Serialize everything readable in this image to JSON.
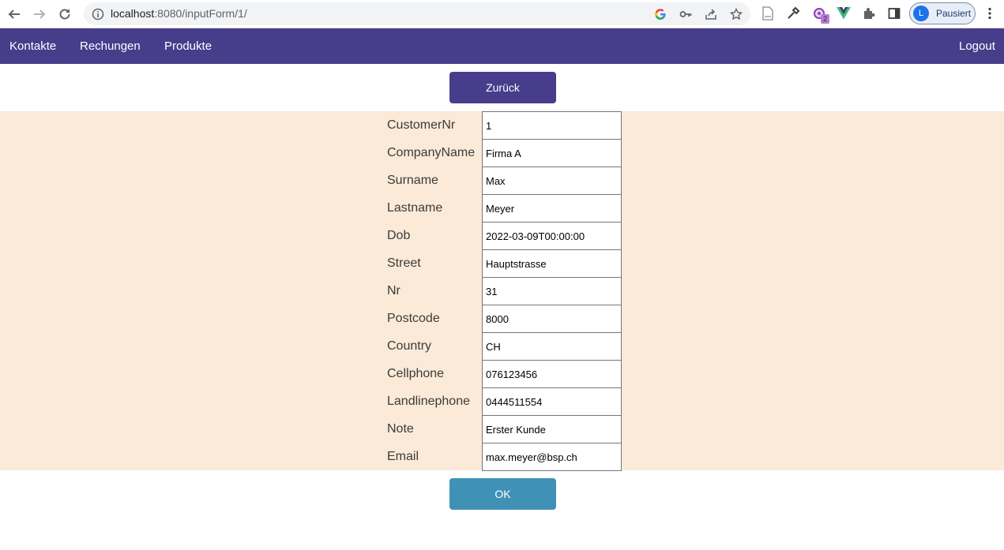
{
  "browser": {
    "url_host": "localhost",
    "url_port_path": ":8080/inputForm/1/",
    "extension_badge": "2",
    "profile_initial": "L",
    "profile_status": "Pausiert"
  },
  "navbar": {
    "items": [
      {
        "label": "Kontakte"
      },
      {
        "label": "Rechungen"
      },
      {
        "label": "Produkte"
      }
    ],
    "logout": "Logout"
  },
  "buttons": {
    "back": "Zurück",
    "ok": "OK"
  },
  "form": {
    "fields": [
      {
        "label": "CustomerNr",
        "value": "1"
      },
      {
        "label": "CompanyName",
        "value": "Firma A"
      },
      {
        "label": "Surname",
        "value": "Max"
      },
      {
        "label": "Lastname",
        "value": "Meyer"
      },
      {
        "label": "Dob",
        "value": "2022-03-09T00:00:00"
      },
      {
        "label": "Street",
        "value": "Hauptstrasse"
      },
      {
        "label": "Nr",
        "value": "31"
      },
      {
        "label": "Postcode",
        "value": "8000"
      },
      {
        "label": "Country",
        "value": "CH"
      },
      {
        "label": "Cellphone",
        "value": "076123456"
      },
      {
        "label": "Landlinephone",
        "value": "0444511554"
      },
      {
        "label": "Note",
        "value": "Erster Kunde"
      },
      {
        "label": "Email",
        "value": "max.meyer@bsp.ch"
      }
    ]
  },
  "colors": {
    "navbar": "#483d8b",
    "back_button": "#483d8b",
    "ok_button": "#3f92b6",
    "form_background": "#fbead7"
  }
}
